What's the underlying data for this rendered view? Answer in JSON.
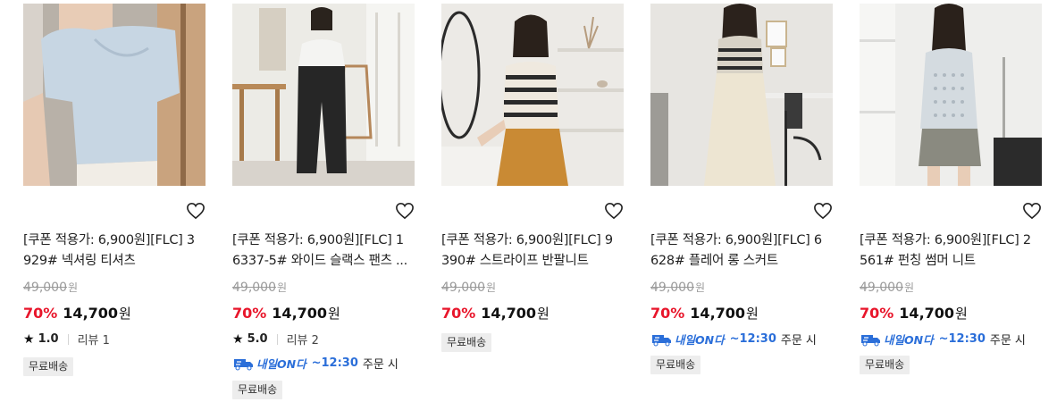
{
  "products": [
    {
      "title_line1": "[쿠폰 적용가: 6,900원][FLC] 3",
      "title_line2": "929# 넥셔링 티셔츠",
      "original_price": "49,000",
      "currency": "원",
      "discount": "70%",
      "price": "14,700",
      "rating": "1.0",
      "reviews": "리뷰 1",
      "shipping": "무료배송",
      "image_palette": {
        "bg": "#b9b2aa",
        "top": "#c7d6e3",
        "skin": "#e9cdb8"
      }
    },
    {
      "title_line1": "[쿠폰 적용가: 6,900원][FLC] 1",
      "title_line2": "6337-5# 와이드 슬랙스 팬츠 ...",
      "original_price": "49,000",
      "currency": "원",
      "discount": "70%",
      "price": "14,700",
      "rating": "5.0",
      "reviews": "리뷰 2",
      "delivery_brand": "내일ON다",
      "delivery_time": "~12:30",
      "delivery_tail": "주문 시",
      "shipping": "무료배송",
      "image_palette": {
        "bg": "#ece9e4",
        "top": "#f4f4f2",
        "bottom": "#2a2a2a"
      }
    },
    {
      "title_line1": "[쿠폰 적용가: 6,900원][FLC] 9",
      "title_line2": "390# 스트라이프 반팔니트",
      "original_price": "49,000",
      "currency": "원",
      "discount": "70%",
      "price": "14,700",
      "shipping": "무료배송",
      "image_palette": {
        "bg": "#ecebe8",
        "top": "#efe9df",
        "bottom": "#c98a34"
      }
    },
    {
      "title_line1": "[쿠폰 적용가: 6,900원][FLC] 6",
      "title_line2": "628# 플레어 롱 스커트",
      "original_price": "49,000",
      "currency": "원",
      "discount": "70%",
      "price": "14,700",
      "delivery_brand": "내일ON다",
      "delivery_time": "~12:30",
      "delivery_tail": "주문 시",
      "shipping": "무료배송",
      "image_palette": {
        "bg": "#e8e6e2",
        "top": "#d8d2c6",
        "bottom": "#ede5d2"
      }
    },
    {
      "title_line1": "[쿠폰 적용가: 6,900원][FLC] 2",
      "title_line2": "561# 펀칭 썸머 니트",
      "original_price": "49,000",
      "currency": "원",
      "discount": "70%",
      "price": "14,700",
      "delivery_brand": "내일ON다",
      "delivery_time": "~12:30",
      "delivery_tail": "주문 시",
      "shipping": "무료배송",
      "image_palette": {
        "bg": "#eeeeec",
        "top": "#d4dbe0",
        "bottom": "#8a8a80"
      }
    }
  ],
  "icons": {
    "wishlist": "heart-outline-icon",
    "rating": "star-icon",
    "delivery": "truck-badge-icon"
  },
  "colors": {
    "discount": "#e8162b",
    "delivery": "#2a6ed9",
    "ship_bg": "#ededed"
  }
}
